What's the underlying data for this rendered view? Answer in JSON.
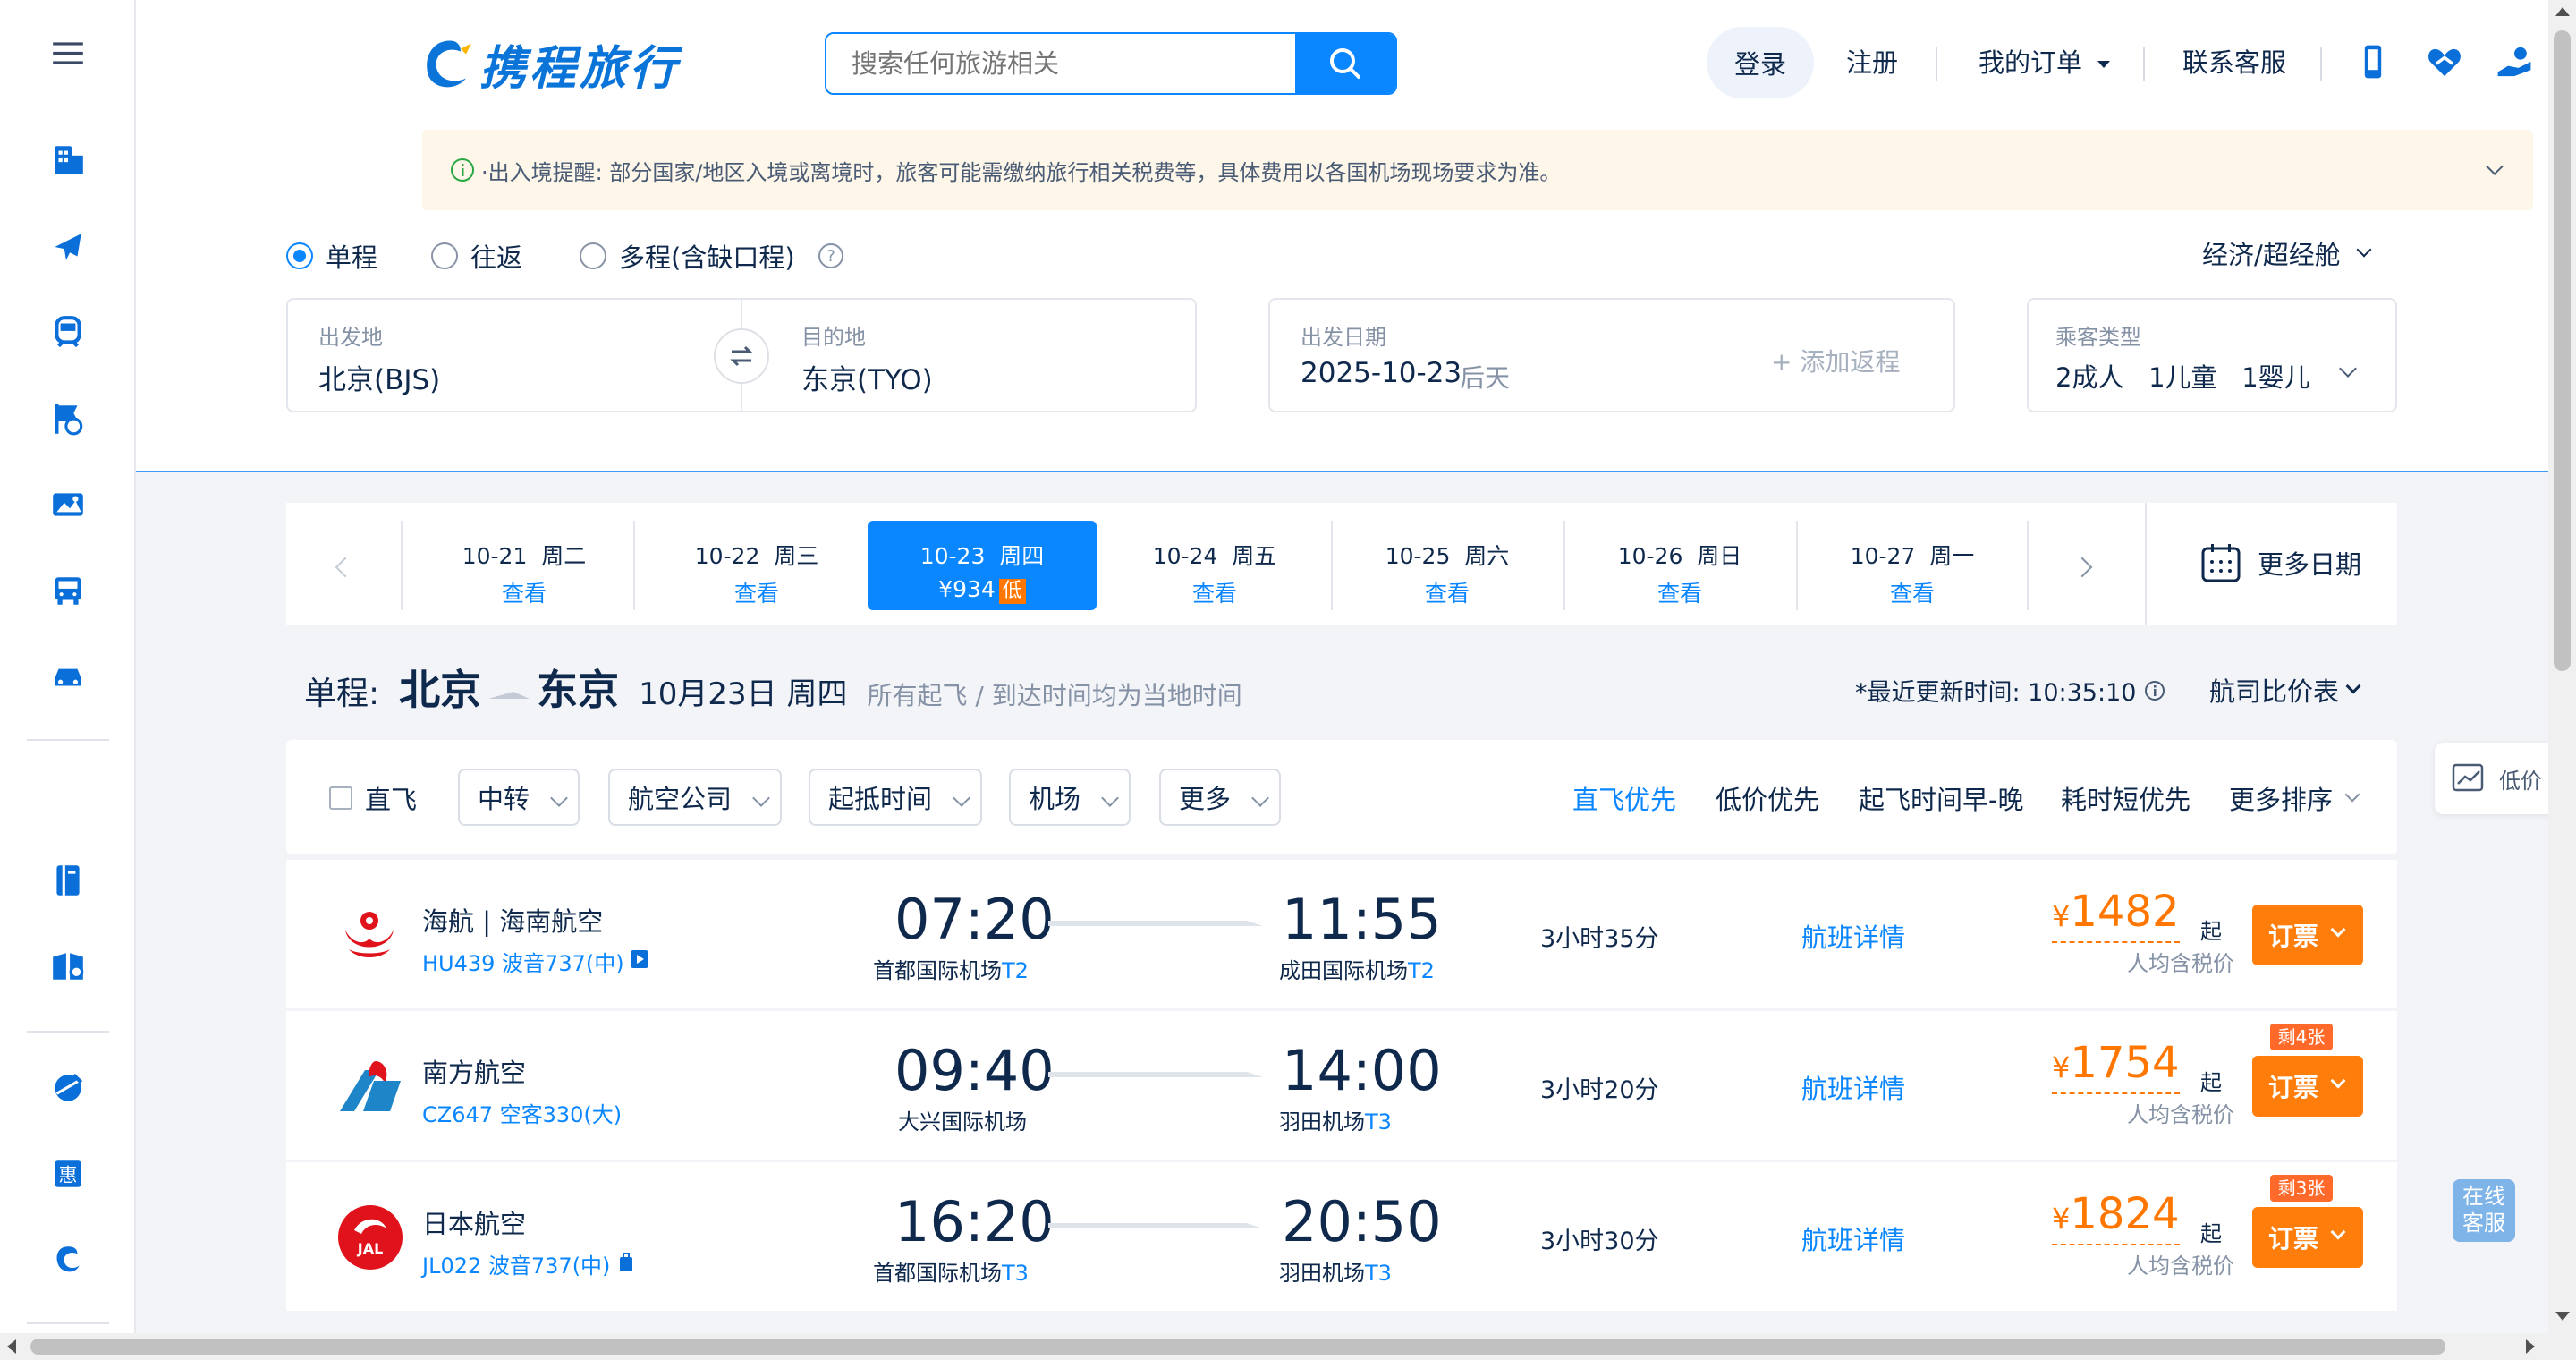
{
  "sidebar": {
    "icons": [
      "menu-icon",
      "hotel-icon",
      "flight-icon",
      "train-icon",
      "attraction-icon",
      "tour-icon",
      "bus-icon",
      "car-icon",
      "guide-icon",
      "visa-icon",
      "global-icon",
      "deals-icon",
      "ctrip-icon"
    ]
  },
  "header": {
    "logo_text": "携程旅行",
    "search_placeholder": "搜索任何旅游相关",
    "login": "登录",
    "register": "注册",
    "my_orders": "我的订单",
    "service": "联系客服"
  },
  "notice": {
    "text": "·出入境提醒: 部分国家/地区入境或离境时，旅客可能需缴纳旅行相关税费等，具体费用以各国机场现场要求为准。"
  },
  "trip_types": [
    "单程",
    "往返",
    "多程(含缺口程)"
  ],
  "cabin": "经济/超经舱",
  "search_form": {
    "from_label": "出发地",
    "from_value": "北京(BJS)",
    "to_label": "目的地",
    "to_value": "东京(TYO)",
    "date_label": "出发日期",
    "date_value": "2025-10-23",
    "date_hint": "后天",
    "add_return": "+ 添加返程",
    "pax_label": "乘客类型",
    "pax_value": "2成人   1儿童   1婴儿"
  },
  "dates": [
    {
      "d": "10-21  周二",
      "p": "查看"
    },
    {
      "d": "10-22  周三",
      "p": "查看"
    },
    {
      "d": "10-23  周四",
      "p": "¥934",
      "low": "低"
    },
    {
      "d": "10-24  周五",
      "p": "查看"
    },
    {
      "d": "10-25  周六",
      "p": "查看"
    },
    {
      "d": "10-26  周日",
      "p": "查看"
    },
    {
      "d": "10-27  周一",
      "p": "查看"
    }
  ],
  "more_dates": "更多日期",
  "route": {
    "prefix": "单程:",
    "from": "北京",
    "to": "东京",
    "date": "10月23日 周四",
    "note": "所有起飞 / 到达时间均为当地时间",
    "updated": "*最近更新时间: 10:35:10",
    "compare": "航司比价表"
  },
  "filters": {
    "direct": "直飞",
    "dropdowns": [
      "中转",
      "航空公司",
      "起抵时间",
      "机场",
      "更多"
    ],
    "sorts": [
      "直飞优先",
      "低价优先",
      "起飞时间早-晚",
      "耗时短优先",
      "更多排序"
    ]
  },
  "side_float": "低价",
  "online_service": "在线\n客服",
  "flights": [
    {
      "airline": "海航 | 海南航空",
      "flight": "HU439 波音737(中)",
      "dep": "07:20",
      "dep_apt": "首都国际机场",
      "dep_t": "T2",
      "arr": "11:55",
      "arr_apt": "成田国际机场",
      "arr_t": "T2",
      "dur": "3小时35分",
      "detail": "航班详情",
      "price": "1482",
      "qi": "起",
      "tax": "人均含税价",
      "book": "订票",
      "left": ""
    },
    {
      "airline": "南方航空",
      "flight": "CZ647 空客330(大)",
      "dep": "09:40",
      "dep_apt": "大兴国际机场",
      "dep_t": "",
      "arr": "14:00",
      "arr_apt": "羽田机场",
      "arr_t": "T3",
      "dur": "3小时20分",
      "detail": "航班详情",
      "price": "1754",
      "qi": "起",
      "tax": "人均含税价",
      "book": "订票",
      "left": "剩4张"
    },
    {
      "airline": "日本航空",
      "flight": "JL022 波音737(中)",
      "dep": "16:20",
      "dep_apt": "首都国际机场",
      "dep_t": "T3",
      "arr": "20:50",
      "arr_apt": "羽田机场",
      "arr_t": "T3",
      "dur": "3小时30分",
      "detail": "航班详情",
      "price": "1824",
      "qi": "起",
      "tax": "人均含税价",
      "book": "订票",
      "left": "剩3张"
    }
  ],
  "colors": {
    "brand": "#0a86ff",
    "price": "#ff7700",
    "book": "#ff7d0b"
  }
}
